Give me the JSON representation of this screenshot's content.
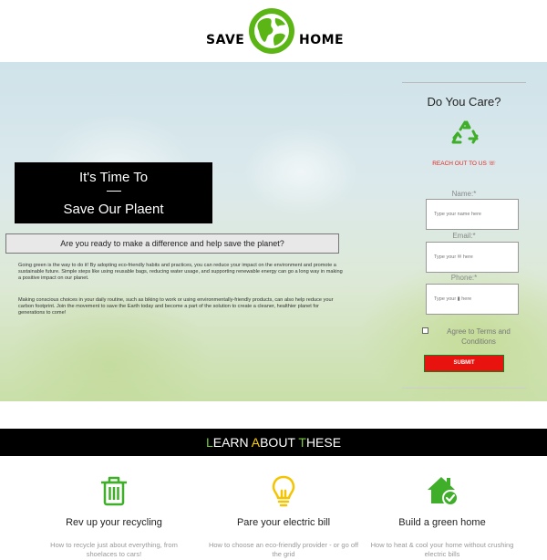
{
  "header": {
    "brand_left": "SAVE",
    "brand_right": "HOME",
    "logo_icon": "globe-icon"
  },
  "hero": {
    "title_line1": "It's Time To",
    "title_line2": "Save Our Plaent",
    "question": "Are you ready to make a difference and help save the planet?",
    "paragraph1": "Going green is the way to do it! By adopting eco-friendly habits and practices, you can reduce your impact on the environment and promote a sustainable future. Simple steps like using reusable bags, reducing water usage, and supporting renewable energy can go a long way in making a positive impact on our planet.",
    "paragraph2": "Making conscious choices in your daily routine, such as biking to work or using environmentally-friendly products, can also help reduce your carbon footprint. Join the movement to save the Earth today and become a part of the solution to create a cleaner, healthier planet for generations to come!"
  },
  "form": {
    "heading": "Do You Care?",
    "reach_out": "REACH OUT TO US",
    "name_label": "Name:*",
    "name_placeholder": "Type your name here",
    "email_label": "Email:*",
    "email_placeholder": "Type your ✉ here",
    "phone_label": "Phone:*",
    "phone_placeholder": "Type your ▮ here",
    "terms": "Agree to Terms and Conditions",
    "submit": "SUBMIT"
  },
  "learn": {
    "title": "LEARN ABOUT THESE",
    "letter_l": "L",
    "rest_l": "EARN ",
    "letter_a": "A",
    "rest_a": "BOUT ",
    "letter_t": "T",
    "rest_t": "HESE",
    "features": [
      {
        "icon": "trash-icon",
        "title": "Rev up your recycling",
        "desc": "How to recycle just about everything, from shoelaces to cars!"
      },
      {
        "icon": "lightbulb-icon",
        "title": "Pare your electric bill",
        "desc": "How to choose an eco-friendly provider - or go off the grid"
      },
      {
        "icon": "green-home-icon",
        "title": "Build a green home",
        "desc": "How to heat & cool your home without crushing electric bills"
      }
    ]
  },
  "colors": {
    "accent_green": "#5bb515",
    "submit_red": "#e8130e",
    "reach_red": "#e3261c",
    "bulb_yellow": "#f5c400"
  }
}
